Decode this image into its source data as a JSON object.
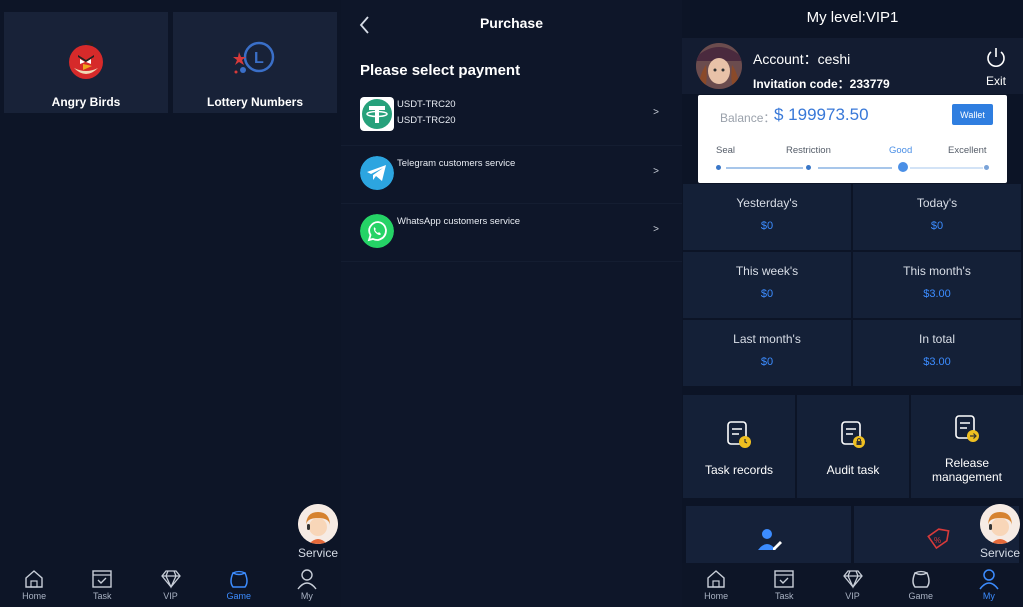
{
  "screen1": {
    "games": [
      {
        "label": "Angry Birds",
        "icon": "angry-bird-icon"
      },
      {
        "label": "Lottery Numbers",
        "icon": "lottery-icon"
      }
    ],
    "service_label": "Service",
    "tabs": [
      {
        "label": "Home",
        "icon": "home-icon"
      },
      {
        "label": "Task",
        "icon": "task-icon"
      },
      {
        "label": "VIP",
        "icon": "diamond-icon"
      },
      {
        "label": "Game",
        "icon": "game-icon",
        "active": true
      },
      {
        "label": "My",
        "icon": "user-icon"
      }
    ]
  },
  "screen2": {
    "title": "Purchase",
    "subtitle": "Please select payment",
    "payments": [
      {
        "line1": "USDT-TRC20",
        "line2": "USDT-TRC20",
        "icon": "tether-icon",
        "color": "#26a17b"
      },
      {
        "line1": "Telegram customers service",
        "line2": "",
        "icon": "telegram-icon",
        "color": "#2ca5e0"
      },
      {
        "line1": "WhatsApp customers service",
        "line2": "",
        "icon": "whatsapp-icon",
        "color": "#25d366"
      }
    ],
    "chevron": ">"
  },
  "screen3": {
    "level": "My level:VIP1",
    "account": "Account：ceshi",
    "invitation": "Invitation code：233779",
    "exit_label": "Exit",
    "balance_label": "Balance：",
    "balance_value": "$ 199973.50",
    "wallet_label": "Wallet",
    "levels": [
      "Seal",
      "Restriction",
      "Good",
      "Excellent"
    ],
    "stats": [
      {
        "label": "Yesterday's",
        "value": "$0"
      },
      {
        "label": "Today's",
        "value": "$0"
      },
      {
        "label": "This week's",
        "value": "$0"
      },
      {
        "label": "This month's",
        "value": "$3.00"
      },
      {
        "label": "Last month's",
        "value": "$0"
      },
      {
        "label": "In total",
        "value": "$3.00"
      }
    ],
    "actions": [
      {
        "label": "Task records"
      },
      {
        "label": "Audit task"
      },
      {
        "label": "Release management"
      }
    ],
    "service_label": "Service",
    "tabs": [
      {
        "label": "Home"
      },
      {
        "label": "Task"
      },
      {
        "label": "VIP"
      },
      {
        "label": "Game"
      },
      {
        "label": "My",
        "active": true
      }
    ]
  },
  "colors": {
    "accent": "#3c8cff",
    "background": "#0c1426",
    "card": "#142037"
  }
}
